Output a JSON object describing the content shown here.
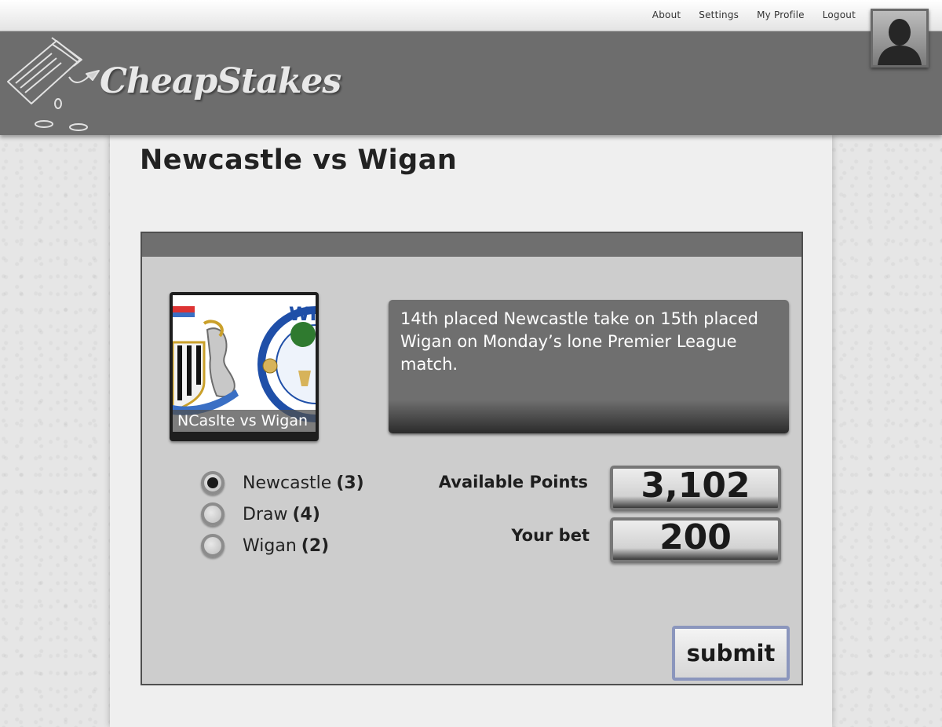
{
  "nav": {
    "items": [
      {
        "label": "About"
      },
      {
        "label": "Settings"
      },
      {
        "label": "My Profile"
      },
      {
        "label": "Logout"
      }
    ]
  },
  "brand": {
    "name": "CheapStakes"
  },
  "page": {
    "title": "Newcastle vs Wigan"
  },
  "match": {
    "image_caption": "NCaslte vs Wigan",
    "description": "14th placed Newcastle take on 15th placed Wigan on Monday’s lone Premier League match."
  },
  "options": [
    {
      "label": "Newcastle",
      "odds": "(3)",
      "selected": true
    },
    {
      "label": "Draw",
      "odds": "(4)",
      "selected": false
    },
    {
      "label": "Wigan",
      "odds": "(2)",
      "selected": false
    }
  ],
  "points": {
    "available_label": "Available Points",
    "available_value": "3,102",
    "bet_label": "Your bet",
    "bet_value": "200"
  },
  "actions": {
    "submit_label": "submit"
  },
  "colors": {
    "header_bg": "#6d6d6d",
    "panel_bg": "#cdcdcd",
    "submit_border": "#8b96bd"
  }
}
